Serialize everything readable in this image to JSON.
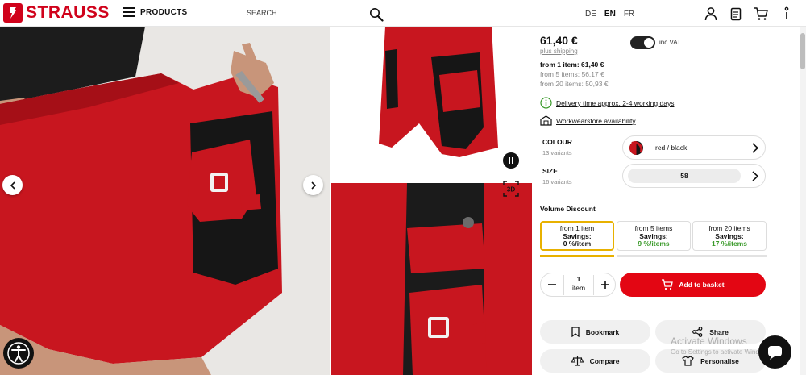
{
  "header": {
    "logo_text": "STRAUSS",
    "menu_label": "PRODUCTS",
    "search_placeholder": "SEARCH",
    "languages": [
      {
        "code": "DE",
        "active": false
      },
      {
        "code": "EN",
        "active": true
      },
      {
        "code": "FR",
        "active": false
      }
    ],
    "icons": [
      "user-icon",
      "notepad-icon",
      "cart-icon",
      "more-vertical-icon"
    ]
  },
  "gallery": {
    "icons": [
      "chevron-left-icon",
      "chevron-right-icon",
      "pause-icon",
      "3d-icon",
      "accessibility-icon"
    ],
    "btn_3d_label": "3D"
  },
  "product": {
    "price": "61,40 €",
    "shipping_link": "plus shipping",
    "vat_toggle_label": "inc VAT",
    "vat_toggle_on": true,
    "tiers": [
      "from 1 item: 61,40 €",
      "from 5 items: 56,17 €",
      "from 20 items: 50,93 €"
    ],
    "delivery_text": "Delivery time approx. 2-4 working days",
    "store_text": "Workwearstore availability",
    "colour": {
      "label": "COLOUR",
      "variants": "13 variants",
      "value": "red / black"
    },
    "size": {
      "label": "SIZE",
      "variants": "16 variants",
      "value": "58"
    },
    "volume_discount_title": "Volume Discount",
    "discounts": [
      {
        "from": "from 1 item",
        "savings_label": "Savings:",
        "savings": "0 %/item"
      },
      {
        "from": "from 5 items",
        "savings_label": "Savings:",
        "savings": "9 %/items"
      },
      {
        "from": "from 20 items",
        "savings_label": "Savings:",
        "savings": "17 %/items"
      }
    ],
    "quantity": {
      "value": "1",
      "unit": "item"
    },
    "add_to_basket": "Add to basket",
    "actions": {
      "bookmark": "Bookmark",
      "share": "Share",
      "compare": "Compare",
      "personalise": "Personalise"
    }
  },
  "overlay": {
    "watermark_title": "Activate Windows",
    "watermark_sub": "Go to Settings to activate Windows."
  },
  "colors": {
    "brand_red": "#d0021b",
    "button_red": "#e30613",
    "selected_border": "#e8b100",
    "savings_green": "#3a9a2a"
  }
}
